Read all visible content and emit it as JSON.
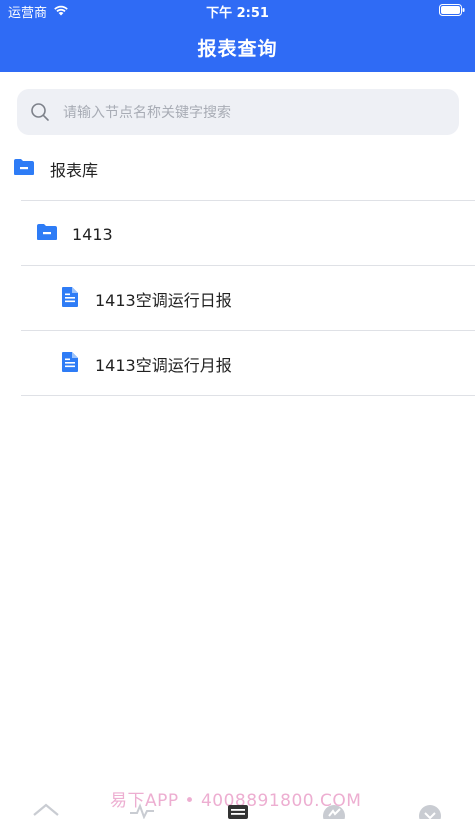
{
  "status_bar": {
    "carrier": "运营商",
    "time": "下午 2:51"
  },
  "header": {
    "title": "报表查询"
  },
  "search": {
    "placeholder": "请输入节点名称关键字搜索"
  },
  "tree": {
    "root": {
      "label": "报表库",
      "icon": "folder-collapse-icon"
    },
    "folder": {
      "label": "1413",
      "icon": "folder-collapse-icon"
    },
    "reports": [
      {
        "label": "1413空调运行日报",
        "icon": "document-icon"
      },
      {
        "label": "1413空调运行月报",
        "icon": "document-icon"
      }
    ]
  },
  "watermark": "易下APP • 4008891800.COM",
  "colors": {
    "primary": "#2f6bf5",
    "icon_blue": "#2e7cf6",
    "divider": "#dfe1e6"
  }
}
